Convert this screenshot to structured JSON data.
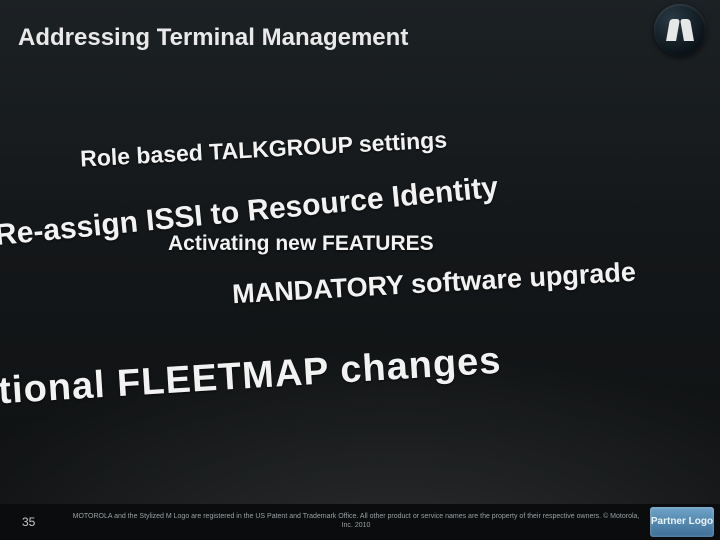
{
  "header": {
    "title": "Addressing Terminal Management"
  },
  "lines": {
    "t1": "Role based TALKGROUP settings",
    "t2": "Re-assign ISSI to Resource Identity",
    "t3": "Activating new FEATURES",
    "t4": "MANDATORY software upgrade",
    "t5": "tional FLEETMAP changes"
  },
  "footer": {
    "page": "35",
    "legal": "MOTOROLA and the Stylized M Logo are registered in the US Patent and Trademark Office. All other product or service names are the property of their respective owners. © Motorola, Inc. 2010",
    "partner_logo": "Partner Logo"
  },
  "logo": {
    "name": "motorola-logo"
  }
}
